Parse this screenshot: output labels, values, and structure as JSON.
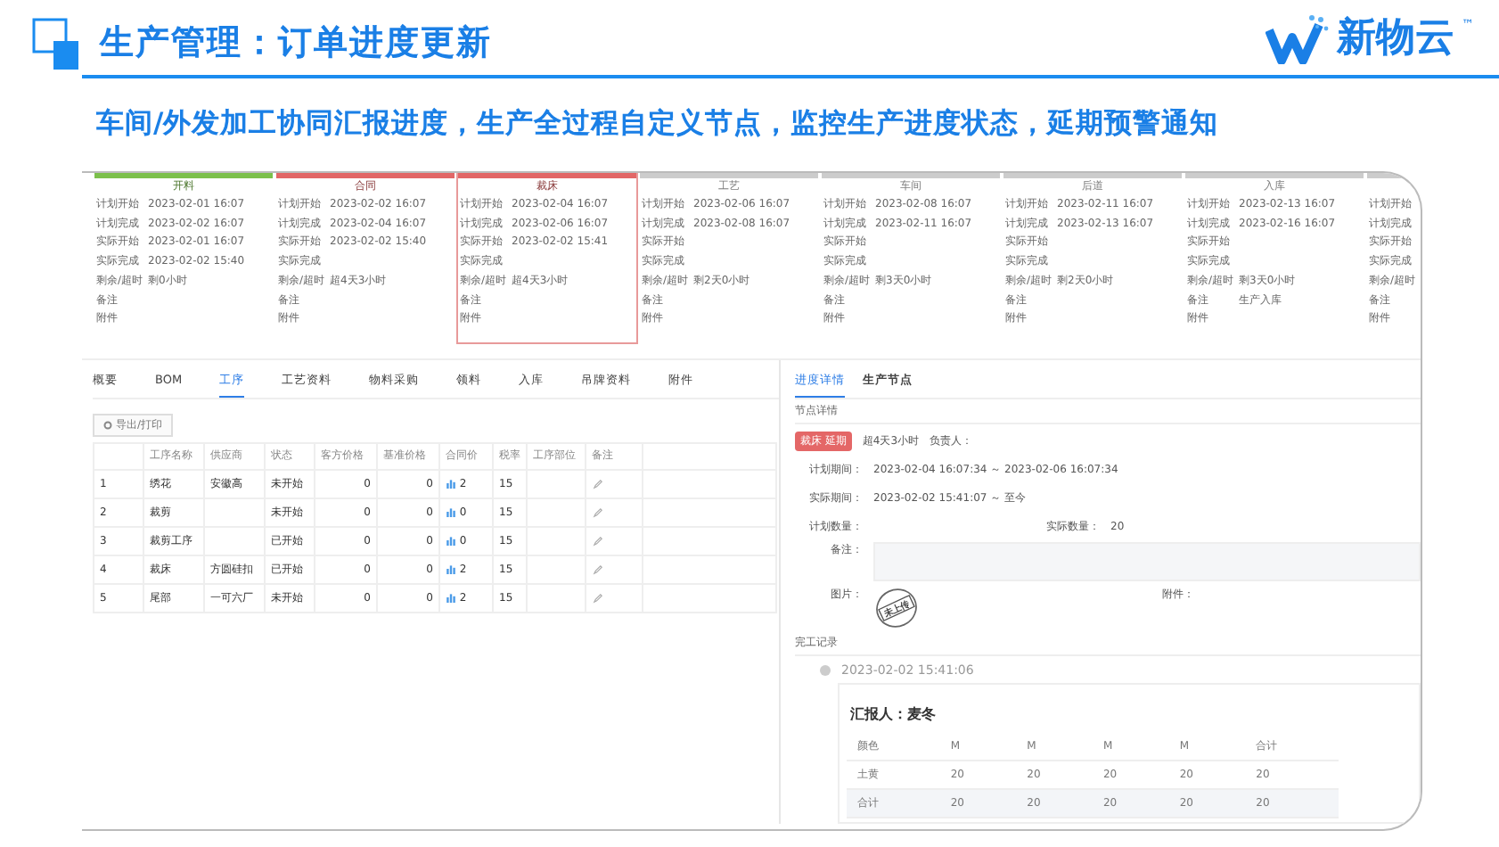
{
  "header": {
    "title": "生产管理：订单进度更新",
    "logo_text": "新物云",
    "logo_mark": "™",
    "subtitle": "车间/外发加工协同汇报进度，生产全过程自定义节点，监控生产进度状态，延期预警通知"
  },
  "stages": [
    {
      "name": "开料",
      "color": "#7cc04b",
      "selected": false,
      "fields": [
        {
          "label": "计划开始",
          "value": "2023-02-01 16:07"
        },
        {
          "label": "计划完成",
          "value": "2023-02-02 16:07"
        },
        {
          "label": "实际开始",
          "value": "2023-02-01 16:07"
        },
        {
          "label": "实际完成",
          "value": "2023-02-02 15:40"
        },
        {
          "label": "剩余/超时",
          "value": "剩0小时"
        },
        {
          "label": "备注"
        },
        {
          "label": "附件"
        }
      ]
    },
    {
      "name": "合同",
      "color": "#e26666",
      "selected": false,
      "fields": [
        {
          "label": "计划开始",
          "value": "2023-02-02 16:07"
        },
        {
          "label": "计划完成",
          "value": "2023-02-04 16:07"
        },
        {
          "label": "实际开始",
          "value": "2023-02-02 15:40"
        },
        {
          "label": "实际完成"
        },
        {
          "label": "剩余/超时",
          "value": "超4天3小时"
        },
        {
          "label": "备注"
        },
        {
          "label": "附件"
        }
      ]
    },
    {
      "name": "裁床",
      "color": "#e26666",
      "selected": true,
      "fields": [
        {
          "label": "计划开始",
          "value": "2023-02-04 16:07"
        },
        {
          "label": "计划完成",
          "value": "2023-02-06 16:07"
        },
        {
          "label": "实际开始",
          "value": "2023-02-02 15:41"
        },
        {
          "label": "实际完成"
        },
        {
          "label": "剩余/超时",
          "value": "超4天3小时"
        },
        {
          "label": "备注"
        },
        {
          "label": "附件"
        }
      ]
    },
    {
      "name": "工艺",
      "color": "#cccccc",
      "selected": false,
      "fields": [
        {
          "label": "计划开始",
          "value": "2023-02-06 16:07"
        },
        {
          "label": "计划完成",
          "value": "2023-02-08 16:07"
        },
        {
          "label": "实际开始"
        },
        {
          "label": "实际完成"
        },
        {
          "label": "剩余/超时",
          "value": "剩2天0小时"
        },
        {
          "label": "备注"
        },
        {
          "label": "附件"
        }
      ]
    },
    {
      "name": "车间",
      "color": "#cccccc",
      "selected": false,
      "fields": [
        {
          "label": "计划开始",
          "value": "2023-02-08 16:07"
        },
        {
          "label": "计划完成",
          "value": "2023-02-11 16:07"
        },
        {
          "label": "实际开始"
        },
        {
          "label": "实际完成"
        },
        {
          "label": "剩余/超时",
          "value": "剩3天0小时"
        },
        {
          "label": "备注"
        },
        {
          "label": "附件"
        }
      ]
    },
    {
      "name": "后道",
      "color": "#cccccc",
      "selected": false,
      "fields": [
        {
          "label": "计划开始",
          "value": "2023-02-11 16:07"
        },
        {
          "label": "计划完成",
          "value": "2023-02-13 16:07"
        },
        {
          "label": "实际开始"
        },
        {
          "label": "实际完成"
        },
        {
          "label": "剩余/超时",
          "value": "剩2天0小时"
        },
        {
          "label": "备注"
        },
        {
          "label": "附件"
        }
      ]
    },
    {
      "name": "入库",
      "color": "#cccccc",
      "selected": false,
      "fields": [
        {
          "label": "计划开始",
          "value": "2023-02-13 16:07"
        },
        {
          "label": "计划完成",
          "value": "2023-02-16 16:07"
        },
        {
          "label": "实际开始"
        },
        {
          "label": "实际完成"
        },
        {
          "label": "剩余/超时",
          "value": "剩3天0小时"
        },
        {
          "label": "备注",
          "value": "生产入库"
        },
        {
          "label": "附件"
        }
      ]
    },
    {
      "color": "#cccccc",
      "selected": false,
      "fields": [
        {
          "label": "计划开始"
        },
        {
          "label": "计划完成"
        },
        {
          "label": "实际开始"
        },
        {
          "label": "实际完成"
        },
        {
          "label": "剩余/超时"
        },
        {
          "label": "备注"
        },
        {
          "label": "附件"
        }
      ]
    }
  ],
  "left": {
    "tabs": [
      {
        "label": "概要",
        "selected": false
      },
      {
        "label": "BOM",
        "selected": false
      },
      {
        "label": "工序",
        "selected": true
      },
      {
        "label": "工艺资料",
        "selected": false
      },
      {
        "label": "物料采购",
        "selected": false
      },
      {
        "label": "领料",
        "selected": false
      },
      {
        "label": "入库",
        "selected": false
      },
      {
        "label": "吊牌资料",
        "selected": false
      },
      {
        "label": "附件",
        "selected": false
      }
    ],
    "export_button": "导出/打印",
    "columns": [
      "工序名称",
      "供应商",
      "状态",
      "客方价格",
      "基准价格",
      "合同价",
      "税率",
      "工序部位",
      "备注"
    ],
    "rows": [
      {
        "no": "1",
        "name": "绣花",
        "supplier": "安徽高",
        "status": "未开始",
        "client_price": "0",
        "base_price": "0",
        "contract_price": "2",
        "tax_rate": "15"
      },
      {
        "no": "2",
        "name": "裁剪",
        "status": "未开始",
        "client_price": "0",
        "base_price": "0",
        "contract_price": "0",
        "tax_rate": "15"
      },
      {
        "no": "3",
        "name": "裁剪工序",
        "status": "已开始",
        "client_price": "0",
        "base_price": "0",
        "contract_price": "0",
        "tax_rate": "15"
      },
      {
        "no": "4",
        "name": "裁床",
        "supplier": "方圆硅扣",
        "status": "已开始",
        "client_price": "0",
        "base_price": "0",
        "contract_price": "2",
        "tax_rate": "15"
      },
      {
        "no": "5",
        "name": "尾部",
        "supplier": "一可六厂",
        "status": "未开始",
        "client_price": "0",
        "base_price": "0",
        "contract_price": "2",
        "tax_rate": "15"
      }
    ]
  },
  "right": {
    "tabs": [
      {
        "label": "进度详情",
        "selected": true
      },
      {
        "label": "生产节点",
        "selected": false
      }
    ],
    "section_title": "节点详情",
    "badge": "裁床 延期",
    "overdue": "超4天3小时",
    "owner_label": "负责人：",
    "plan_period_label": "计划期间：",
    "plan_period": "2023-02-04 16:07:34 ～ 2023-02-06 16:07:34",
    "actual_period_label": "实际期间：",
    "actual_period": "2023-02-02 15:41:07 ～ 至今",
    "plan_qty_label": "计划数量：",
    "actual_qty_label": "实际数量：",
    "actual_qty": "20",
    "remark_label": "备注：",
    "picture_label": "图片：",
    "stamp_text": "未上传",
    "attachment_label": "附件：",
    "record_title": "完工记录",
    "record_time": "2023-02-02 15:41:06",
    "reporter": "汇报人：麦冬",
    "record_columns": [
      "颜色",
      "M",
      "M",
      "M",
      "M",
      "合计"
    ],
    "record_rows": [
      [
        "土黄",
        "20",
        "20",
        "20",
        "20",
        "20"
      ],
      [
        "合计",
        "20",
        "20",
        "20",
        "20",
        "20"
      ]
    ]
  }
}
